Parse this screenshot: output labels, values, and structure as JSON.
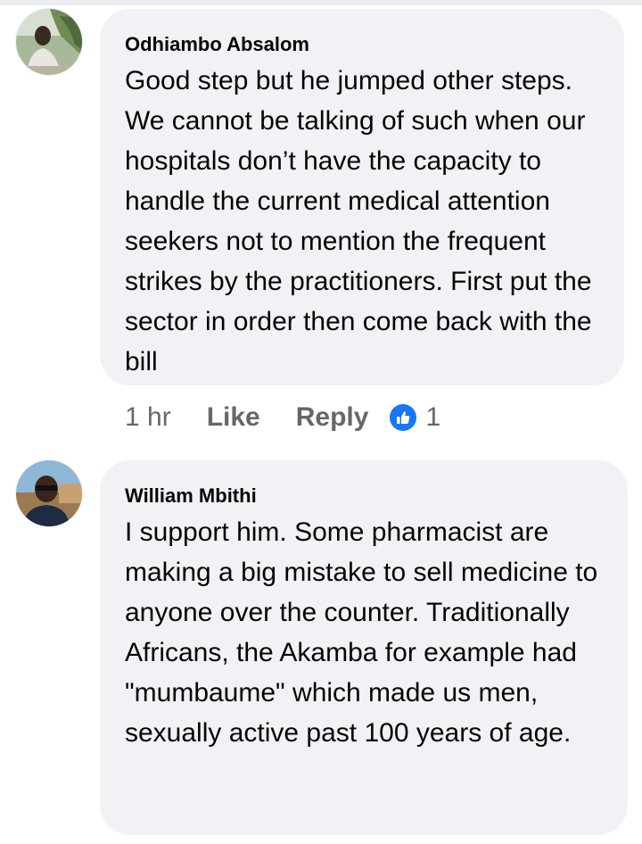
{
  "colors": {
    "bubble_bg": "#f0f2f5",
    "text": "#050505",
    "secondary_text": "#65676b",
    "like_blue": "#1877f2"
  },
  "comments": [
    {
      "author": "Odhiambo Absalom",
      "avatar_icon": "profile-photo-avatar",
      "text": "Good step but he jumped other steps. We cannot be talking of such when our hospitals don’t have the capacity to handle the current medical attention seekers not to mention the frequent strikes by the practitioners. First put the sector in order then come back with the bill",
      "time": "1 hr",
      "like_label": "Like",
      "reply_label": "Reply",
      "reaction_icon": "thumbs-up-icon",
      "reaction_count": "1"
    },
    {
      "author": "William Mbithi",
      "avatar_icon": "profile-photo-avatar",
      "text": "I support him. Some pharmacist are making a big mistake to sell medicine to anyone over the counter. Traditionally Africans, the Akamba for example had \"mumbaume\" which made us men, sexually active past 100 years of age."
    }
  ]
}
